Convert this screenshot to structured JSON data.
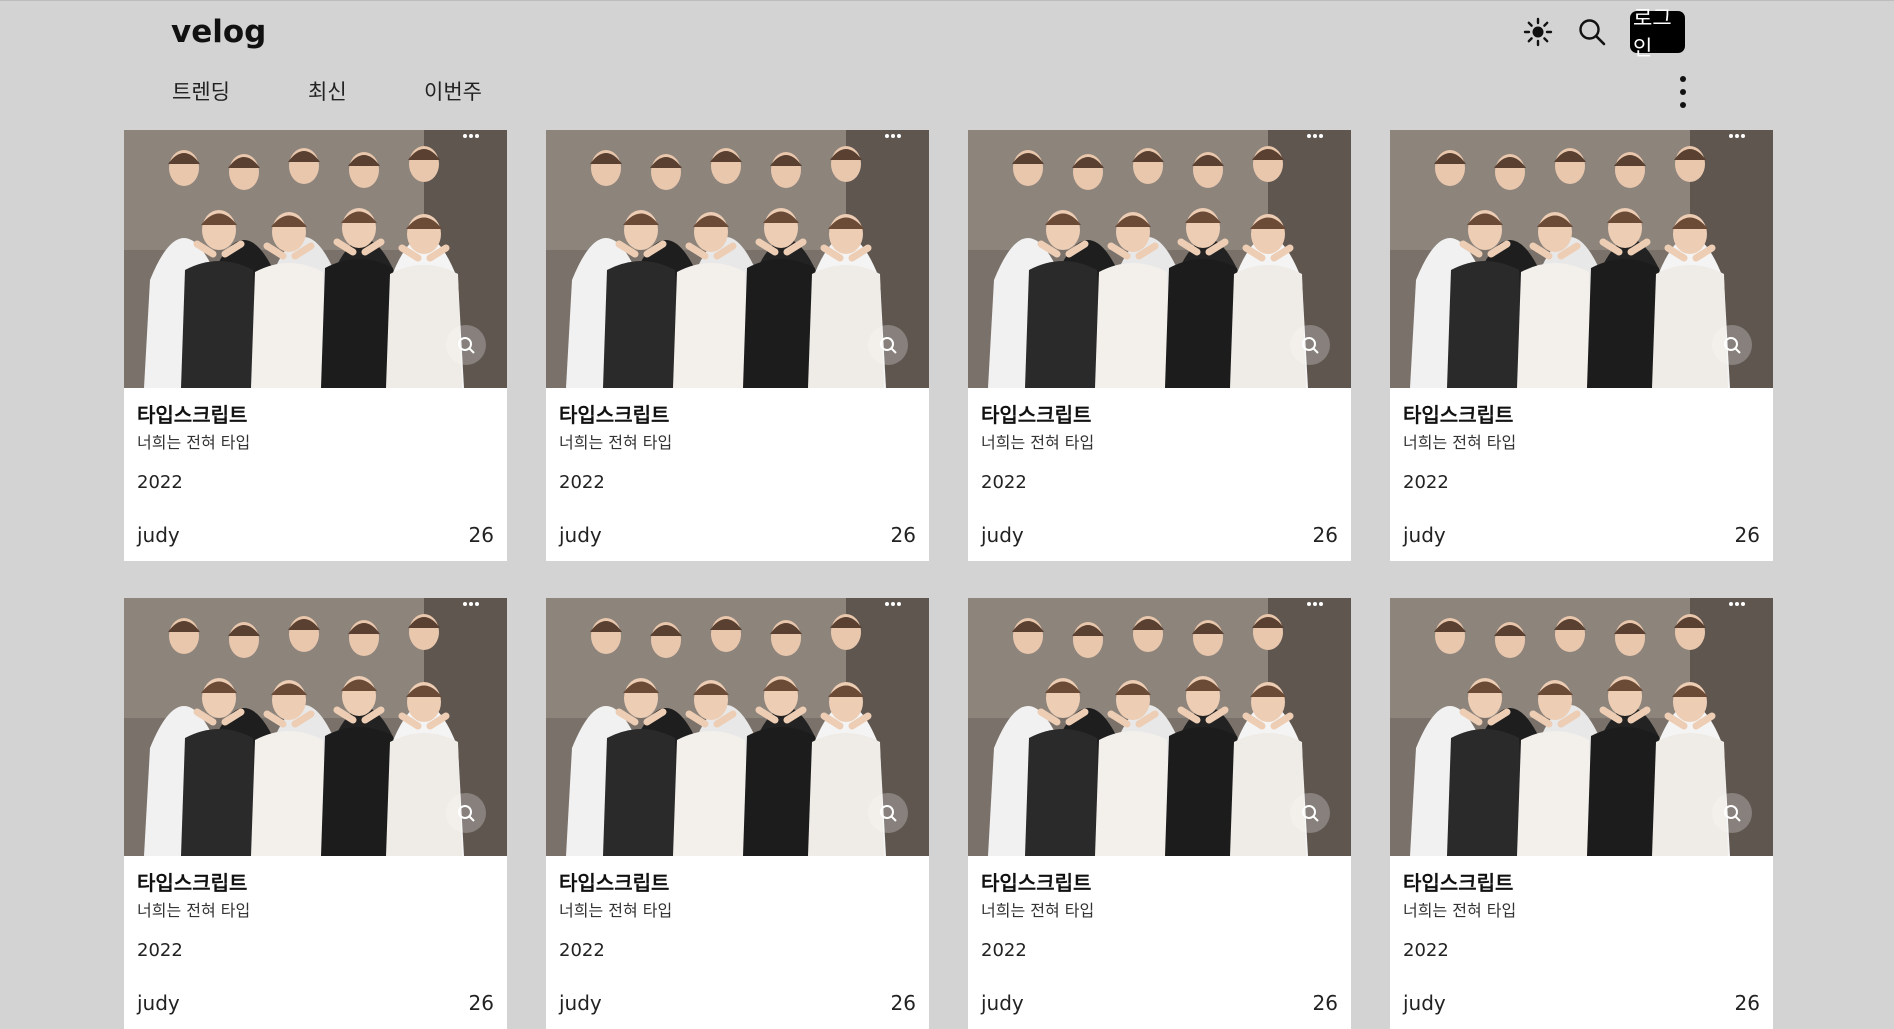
{
  "header": {
    "logo": "velog",
    "login_label": "로그인",
    "icons": {
      "theme": "sun-icon",
      "search": "search-icon",
      "more": "more-vertical-icon"
    }
  },
  "tabs": [
    {
      "label": "트렌딩"
    },
    {
      "label": "최신"
    },
    {
      "label": "이번주"
    }
  ],
  "posts": [
    {
      "title": "타입스크립트",
      "description": "너희는 전혀 타입",
      "date": "2022",
      "author": "judy",
      "likes": "26"
    },
    {
      "title": "타입스크립트",
      "description": "너희는 전혀 타입",
      "date": "2022",
      "author": "judy",
      "likes": "26"
    },
    {
      "title": "타입스크립트",
      "description": "너희는 전혀 타입",
      "date": "2022",
      "author": "judy",
      "likes": "26"
    },
    {
      "title": "타입스크립트",
      "description": "너희는 전혀 타입",
      "date": "2022",
      "author": "judy",
      "likes": "26"
    },
    {
      "title": "타입스크립트",
      "description": "너희는 전혀 타입",
      "date": "2022",
      "author": "judy",
      "likes": "26"
    },
    {
      "title": "타입스크립트",
      "description": "너희는 전혀 타입",
      "date": "2022",
      "author": "judy",
      "likes": "26"
    },
    {
      "title": "타입스크립트",
      "description": "너희는 전혀 타입",
      "date": "2022",
      "author": "judy",
      "likes": "26"
    },
    {
      "title": "타입스크립트",
      "description": "너희는 전혀 타입",
      "date": "2022",
      "author": "judy",
      "likes": "26"
    }
  ],
  "colors": {
    "page_bg": "#d3d3d3",
    "card_bg": "#ffffff",
    "login_bg": "#000000"
  }
}
